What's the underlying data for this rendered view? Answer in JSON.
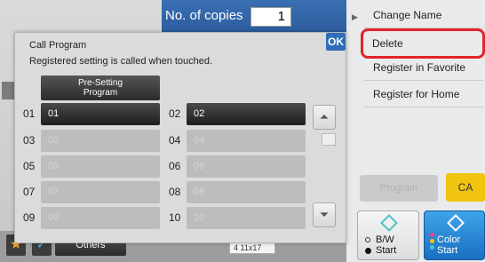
{
  "header": {
    "copies_label": "No. of copies",
    "copies_value": "1"
  },
  "menu": {
    "items": [
      "Change Name",
      "Delete",
      "Register in Favorite",
      "Register for Home"
    ],
    "highlighted": "Delete"
  },
  "controls": {
    "program_label": "Program",
    "ca_label": "CA",
    "bw_label": "B/W",
    "bw_start": "Start",
    "color_label": "Color",
    "color_start": "Start"
  },
  "dialog": {
    "title": "Call Program",
    "description": "Registered setting is called when touched.",
    "ok_label": "OK",
    "preset_label_line1": "Pre-Setting",
    "preset_label_line2": "Program",
    "programs": [
      {
        "num": "01",
        "label": "01",
        "active": true
      },
      {
        "num": "02",
        "label": "02",
        "active": true
      },
      {
        "num": "03",
        "label": "03",
        "active": false
      },
      {
        "num": "04",
        "label": "04",
        "active": false
      },
      {
        "num": "05",
        "label": "05",
        "active": false
      },
      {
        "num": "06",
        "label": "06",
        "active": false
      },
      {
        "num": "07",
        "label": "07",
        "active": false
      },
      {
        "num": "08",
        "label": "08",
        "active": false
      },
      {
        "num": "09",
        "label": "09",
        "active": false
      },
      {
        "num": "10",
        "label": "10",
        "active": false
      }
    ],
    "scroll_up_icon": "double-chevron-up",
    "scroll_down_icon": "double-chevron-down"
  },
  "toolbar": {
    "others_label": "Others",
    "paper_chip": "4   11x17"
  },
  "colors": {
    "accent": "#2f6db8",
    "highlight": "#e0242c",
    "ca": "#f1c40f"
  }
}
